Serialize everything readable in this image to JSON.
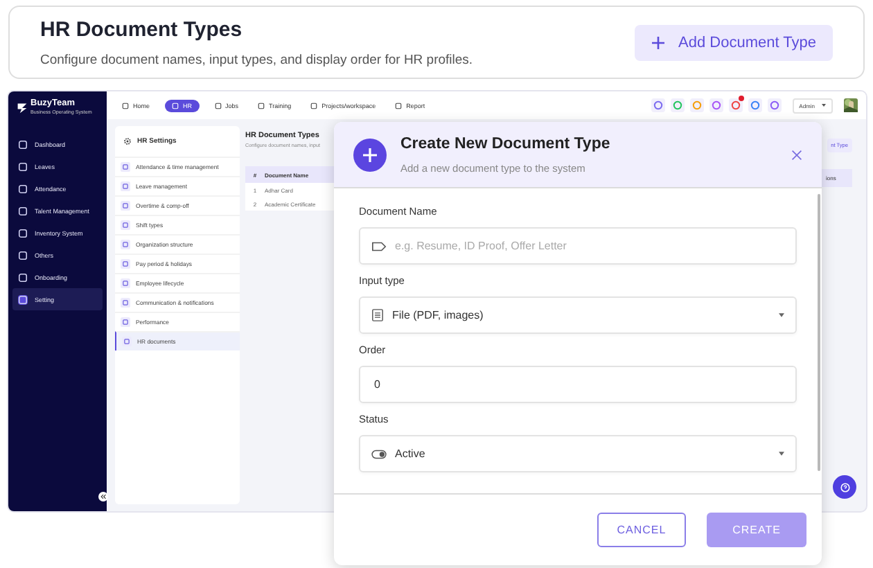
{
  "header": {
    "title": "HR Document Types",
    "subtitle": "Configure document names, input types, and display order for HR profiles.",
    "button": "Add Document Type"
  },
  "app": {
    "logo": "BuzyTeam",
    "logo_tagline": "Business Operating System",
    "sidebar": [
      {
        "label": "Dashboard",
        "selected": false
      },
      {
        "label": "Leaves",
        "selected": false
      },
      {
        "label": "Attendance",
        "selected": false
      },
      {
        "label": "Talent Management",
        "selected": false
      },
      {
        "label": "Inventory System",
        "selected": false
      },
      {
        "label": "Others",
        "selected": false
      },
      {
        "label": "Onboarding",
        "selected": false
      },
      {
        "label": "Setting",
        "selected": true
      }
    ],
    "nav": [
      {
        "label": "Home",
        "selected": false
      },
      {
        "label": "HR",
        "selected": true
      },
      {
        "label": "Jobs",
        "selected": false
      },
      {
        "label": "Training",
        "selected": false
      },
      {
        "label": "Projects/workspace",
        "selected": false
      },
      {
        "label": "Report",
        "selected": false
      }
    ],
    "toolbar_icons": [
      {
        "color": "#7c6cf0",
        "badge": false
      },
      {
        "color": "#22c55e",
        "badge": false
      },
      {
        "color": "#f59e0b",
        "badge": false
      },
      {
        "color": "#a855f7",
        "badge": false
      },
      {
        "color": "#ef4444",
        "badge": true
      },
      {
        "color": "#3b82f6",
        "badge": false
      },
      {
        "color": "#8b5cf6",
        "badge": false
      }
    ],
    "role": "Admin",
    "settings": {
      "title": "HR Settings",
      "items": [
        {
          "label": "Attendance & time management",
          "selected": false
        },
        {
          "label": "Leave management",
          "selected": false
        },
        {
          "label": "Overtime & comp-off",
          "selected": false
        },
        {
          "label": "Shift types",
          "selected": false
        },
        {
          "label": "Organization structure",
          "selected": false
        },
        {
          "label": "Pay period & holidays",
          "selected": false
        },
        {
          "label": "Employee lifecycle",
          "selected": false
        },
        {
          "label": "Communication & notifications",
          "selected": false
        },
        {
          "label": "Performance",
          "selected": false
        },
        {
          "label": "HR documents",
          "selected": true
        }
      ]
    },
    "content": {
      "title": "HR Document Types",
      "subtitle": "Configure document names, input",
      "columns": [
        "#",
        "Document Name"
      ],
      "rows": [
        [
          "1",
          "Adhar Card"
        ],
        [
          "2",
          "Academic Certificate"
        ]
      ],
      "button_fragment": "nt Type",
      "column_fragment": "ions"
    }
  },
  "modal": {
    "title": "Create New Document Type",
    "subtitle": "Add a new document type to the system",
    "fields": [
      {
        "kind": "text",
        "label": "Document Name",
        "placeholder": "e.g. Resume, ID Proof, Offer Letter"
      },
      {
        "kind": "file_select",
        "label": "Input type",
        "value": "File (PDF, images)"
      },
      {
        "kind": "number",
        "label": "Order",
        "value": "0"
      },
      {
        "kind": "toggle_select",
        "label": "Status",
        "value": "Active"
      }
    ],
    "buttons": [
      {
        "kind": "outline",
        "label": "CANCEL",
        "disabled": false
      },
      {
        "kind": "primary",
        "label": "CREATE",
        "disabled": true
      }
    ]
  }
}
